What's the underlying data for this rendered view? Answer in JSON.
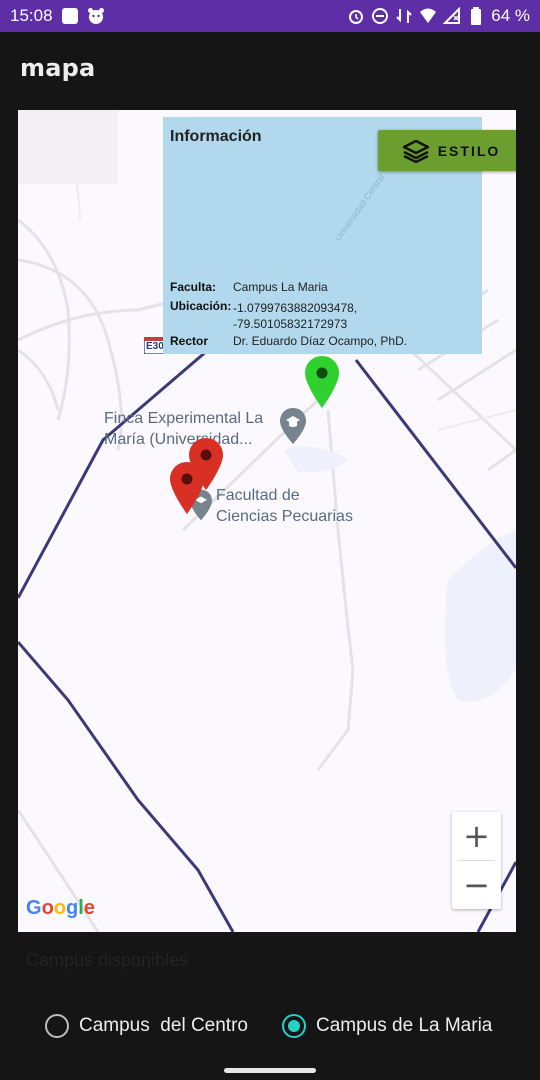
{
  "status_bar": {
    "time": "15:08",
    "battery": "64 %",
    "icons": [
      "gallery-icon",
      "face-icon",
      "alarm-icon",
      "dnd-icon",
      "data-icon",
      "wifi-icon",
      "signal-icon",
      "battery-icon"
    ],
    "color": "#5e2ea7"
  },
  "app_bar": {
    "title": "mapa"
  },
  "map": {
    "info": {
      "title": "Información",
      "faculta_label": "Faculta:",
      "faculta_value": "Campus La Maria",
      "ubicacion_label": "Ubicación:",
      "ubicacion_line1": "-1.0799763882093478,",
      "ubicacion_line2": "-79.50105832172973",
      "rector_label": "Rector",
      "rector_value": "Dr. Eduardo Díaz Ocampo, PhD."
    },
    "style_button": {
      "label": "ESTILO",
      "color": "#6b9e2e"
    },
    "road_shield": "E30",
    "poi_finca_line1": "Finca Experimental La",
    "poi_finca_line2": "María (Universidad...",
    "poi_facultad_line1": "Facultad de",
    "poi_facultad_line2": "Ciencias Pecuarias",
    "road_name": "Universidad Central",
    "zoom_in": "+",
    "zoom_out": "−",
    "google": [
      "G",
      "o",
      "o",
      "g",
      "l",
      "e"
    ],
    "marker_colors": {
      "selected": "#2ed12e",
      "other": "#d93025"
    }
  },
  "bottom": {
    "caption": "Campus disponibles",
    "options": [
      {
        "label": "Campus  del Centro",
        "selected": false
      },
      {
        "label": "Campus de La Maria",
        "selected": true
      }
    ],
    "accent": "#22d3c5"
  }
}
